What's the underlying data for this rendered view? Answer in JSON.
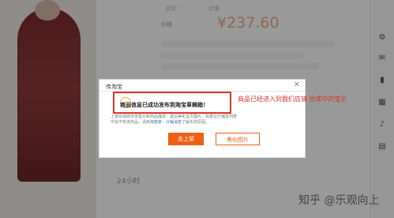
{
  "background": {
    "tabs": [
      "折扣",
      "优惠"
    ],
    "price_label": "价格",
    "price_old": "¥",
    "price": "¥237.60",
    "sold_text": "",
    "lower_right_text": "24小时"
  },
  "dialog": {
    "title": "传淘宝",
    "close_glyph": "✕",
    "success_message": "商品信息已成功发布到淘宝草稿箱！",
    "desc_line1": "上架前请修改零售价和商品描述，建议美化宝贝图片，如果在已铺货列表",
    "desc_line2_pre": "中找不到该商品，请到",
    "desc_link1": "淘管家",
    "desc_sep": " - ",
    "desc_link2": "分销消息",
    "desc_line2_post": "了解失败原因。",
    "buttons": {
      "list_now": "去上架",
      "beautify": "美化图片"
    }
  },
  "annotation": {
    "text": "商品已经进入到我们店铺 仓库中的宝贝",
    "color": "#d7302d"
  },
  "watermark": "知乎 @乐观向上",
  "colors": {
    "primary_button": "#ee5f18",
    "highlight_border": "#e0322c",
    "success_icon": "#f2a93b",
    "link": "#2f65b3"
  },
  "icons": {
    "success": "✓",
    "dock": [
      "gear-icon",
      "mail-icon",
      "bookmark-icon",
      "chart-icon",
      "bell-icon",
      "doc-icon"
    ]
  }
}
